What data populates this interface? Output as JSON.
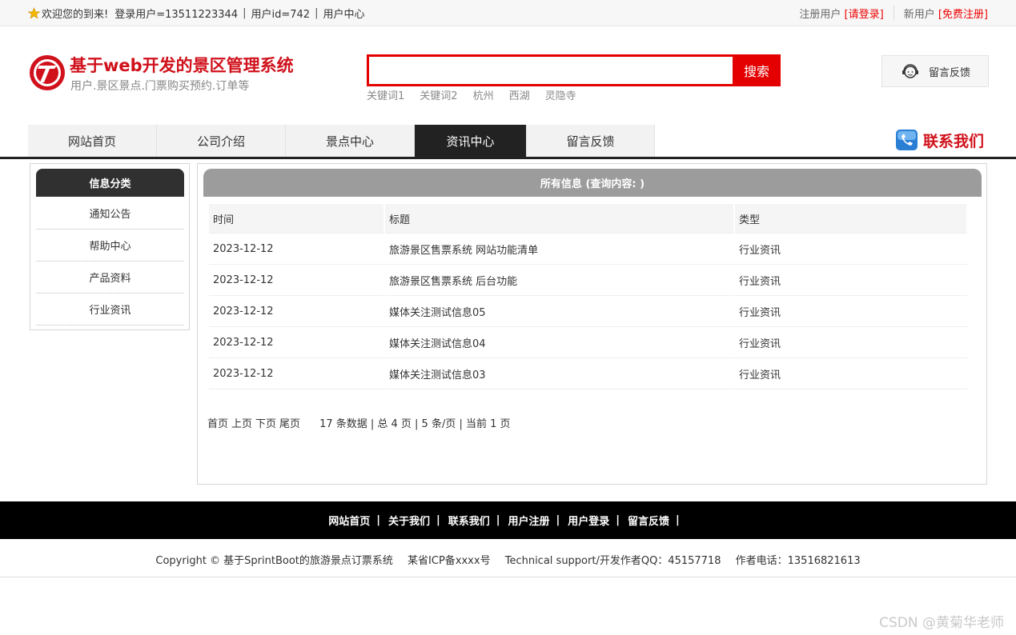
{
  "topbar": {
    "welcome": "欢迎您的到来!",
    "login_user": "登录用户=13511223344",
    "user_id": "用户id=742",
    "user_center": "用户中心",
    "register_user_label": "注册用户",
    "login_link": "[请登录]",
    "new_user_label": "新用户",
    "register_link": "[免费注册]"
  },
  "header": {
    "site_title": "基于web开发的景区管理系统",
    "site_subtitle": "用户.景区景点.门票购买预约.订单等",
    "search_placeholder": "",
    "search_button": "搜索",
    "keywords": [
      "关键词1",
      "关键词2",
      "杭州",
      "西湖",
      "灵隐寺"
    ],
    "feedback_label": "留言反馈"
  },
  "nav": {
    "items": [
      "网站首页",
      "公司介绍",
      "景点中心",
      "资讯中心",
      "留言反馈"
    ],
    "active_index": 3,
    "contact_label": "联系我们"
  },
  "sidebar": {
    "title": "信息分类",
    "items": [
      "通知公告",
      "帮助中心",
      "产品资料",
      "行业资讯"
    ]
  },
  "main": {
    "title": "所有信息 (查询内容: )",
    "columns": [
      "时间",
      "标题",
      "类型"
    ],
    "rows": [
      [
        "2023-12-12",
        "旅游景区售票系统 网站功能清单",
        "行业资讯"
      ],
      [
        "2023-12-12",
        "旅游景区售票系统 后台功能",
        "行业资讯"
      ],
      [
        "2023-12-12",
        "媒体关注测试信息05",
        "行业资讯"
      ],
      [
        "2023-12-12",
        "媒体关注测试信息04",
        "行业资讯"
      ],
      [
        "2023-12-12",
        "媒体关注测试信息03",
        "行业资讯"
      ]
    ],
    "pager": {
      "first": "首页",
      "prev": "上页",
      "next": "下页",
      "last": "尾页",
      "summary": "17 条数据 | 总 4 页 | 5 条/页 | 当前 1 页"
    }
  },
  "footer": {
    "links": [
      "网站首页",
      "关于我们",
      "联系我们",
      "用户注册",
      "用户登录",
      "留言反馈"
    ],
    "copyright": "Copyright © 基于SprintBoot的旅游景点订票系统",
    "icp": "某省ICP备xxxx号",
    "support": "Technical support/开发作者QQ：45157718",
    "phone": "作者电话：13516821613"
  },
  "watermark": "CSDN @黄菊华老师",
  "colors": {
    "brand_red": "#d0111b",
    "search_red": "#e40000",
    "nav_active": "#222222",
    "main_header": "#9c9c9c"
  }
}
